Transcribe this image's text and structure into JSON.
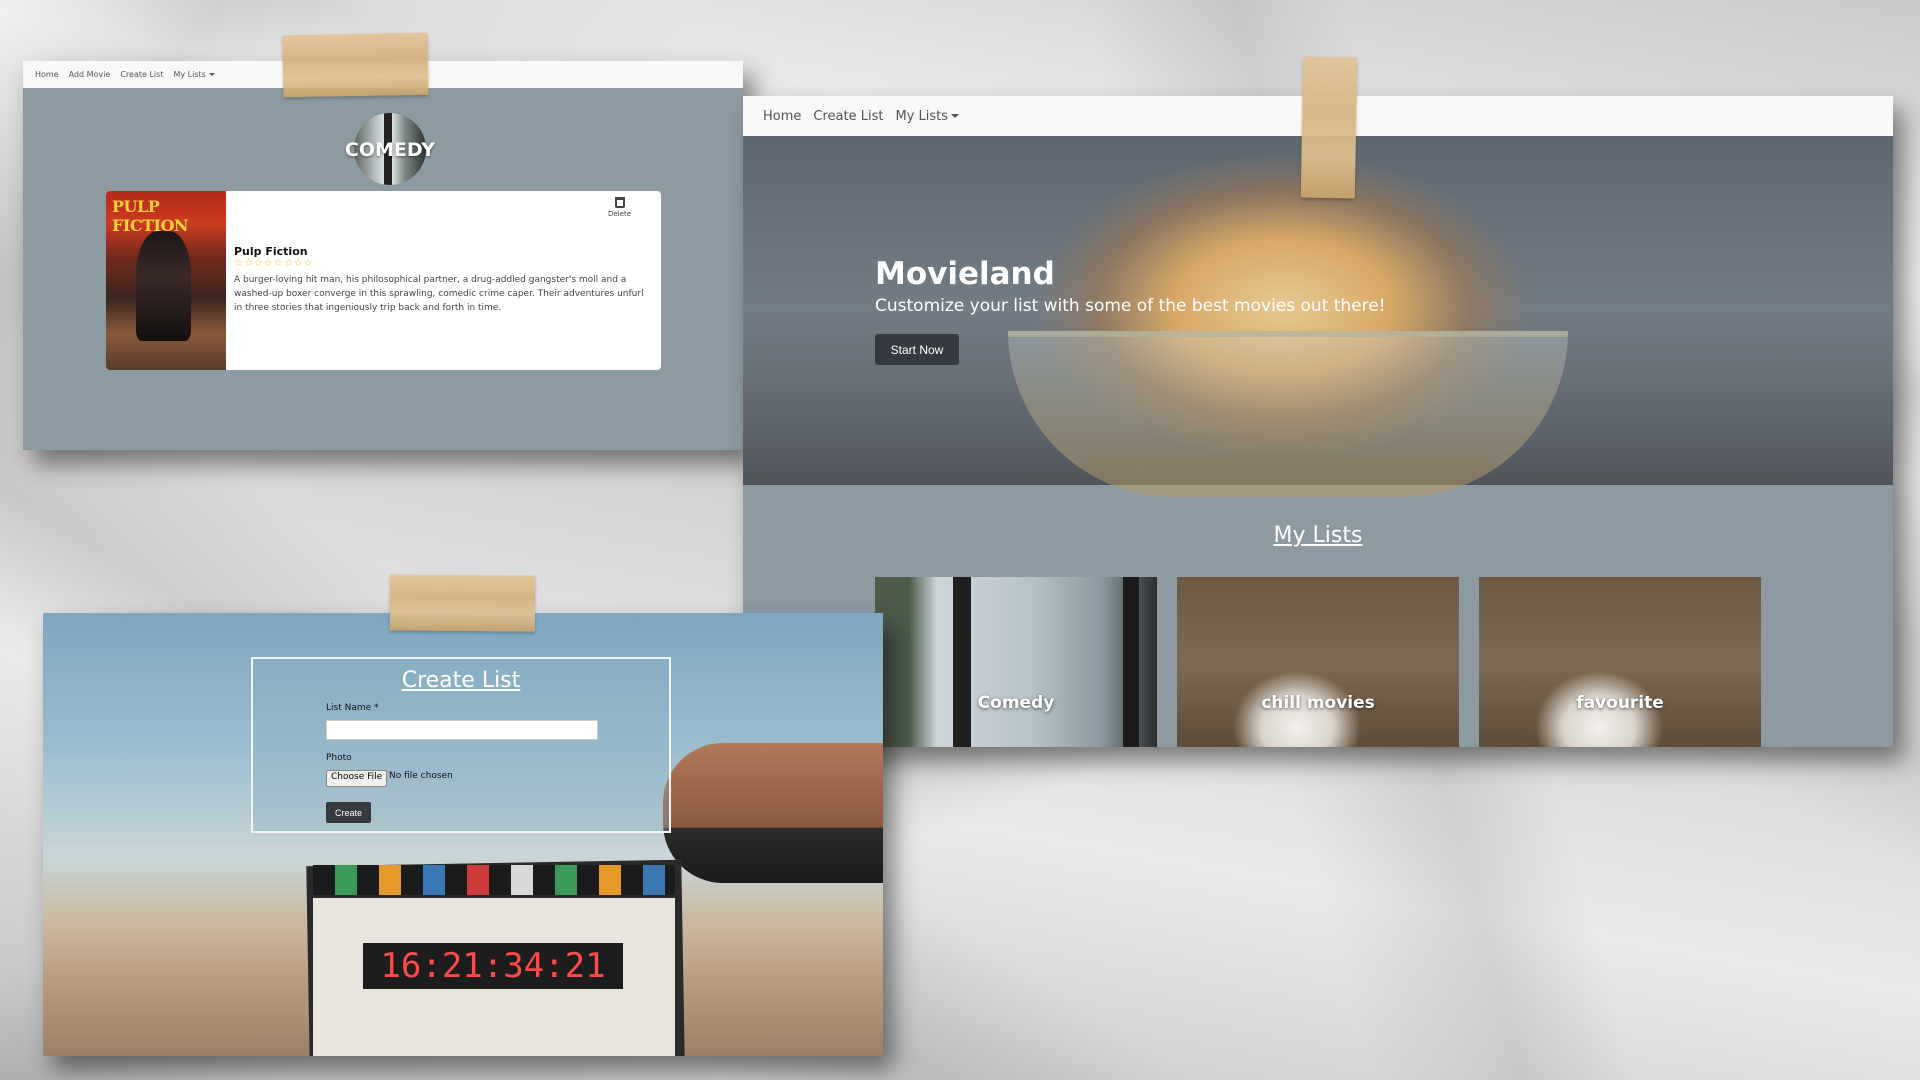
{
  "comedy_page": {
    "nav": [
      "Home",
      "Add Movie",
      "Create List",
      "My Lists"
    ],
    "list_title": "COMEDY",
    "movie": {
      "poster_text": "PULP FICTION",
      "title": "Pulp Fiction",
      "stars": "☆☆☆☆☆☆☆☆",
      "description": "A burger-loving hit man, his philosophical partner, a drug-addled gangster's moll and a washed-up boxer converge in this sprawling, comedic crime caper. Their adventures unfurl in three stories that ingeniously trip back and forth in time.",
      "delete_label": "Delete"
    }
  },
  "home_page": {
    "nav": [
      "Home",
      "Create List",
      "My Lists"
    ],
    "hero": {
      "title": "Movieland",
      "subtitle": "Customize your list with some of the best movies out there!",
      "button": "Start Now"
    },
    "lists_heading": "My Lists",
    "lists": [
      "Comedy",
      "chill movies",
      "favourite"
    ]
  },
  "create_page": {
    "title": "Create List",
    "list_name_label": "List Name",
    "required_mark": "*",
    "photo_label": "Photo",
    "file_button": "Choose File",
    "file_status": "No file chosen",
    "submit": "Create",
    "slate_digits": "16:21:34:21"
  },
  "colors": {
    "navbar": "#f7f8f7",
    "page_bg": "#8c9aa2",
    "dark_button": "#343a40",
    "star": "#e0c21b"
  }
}
